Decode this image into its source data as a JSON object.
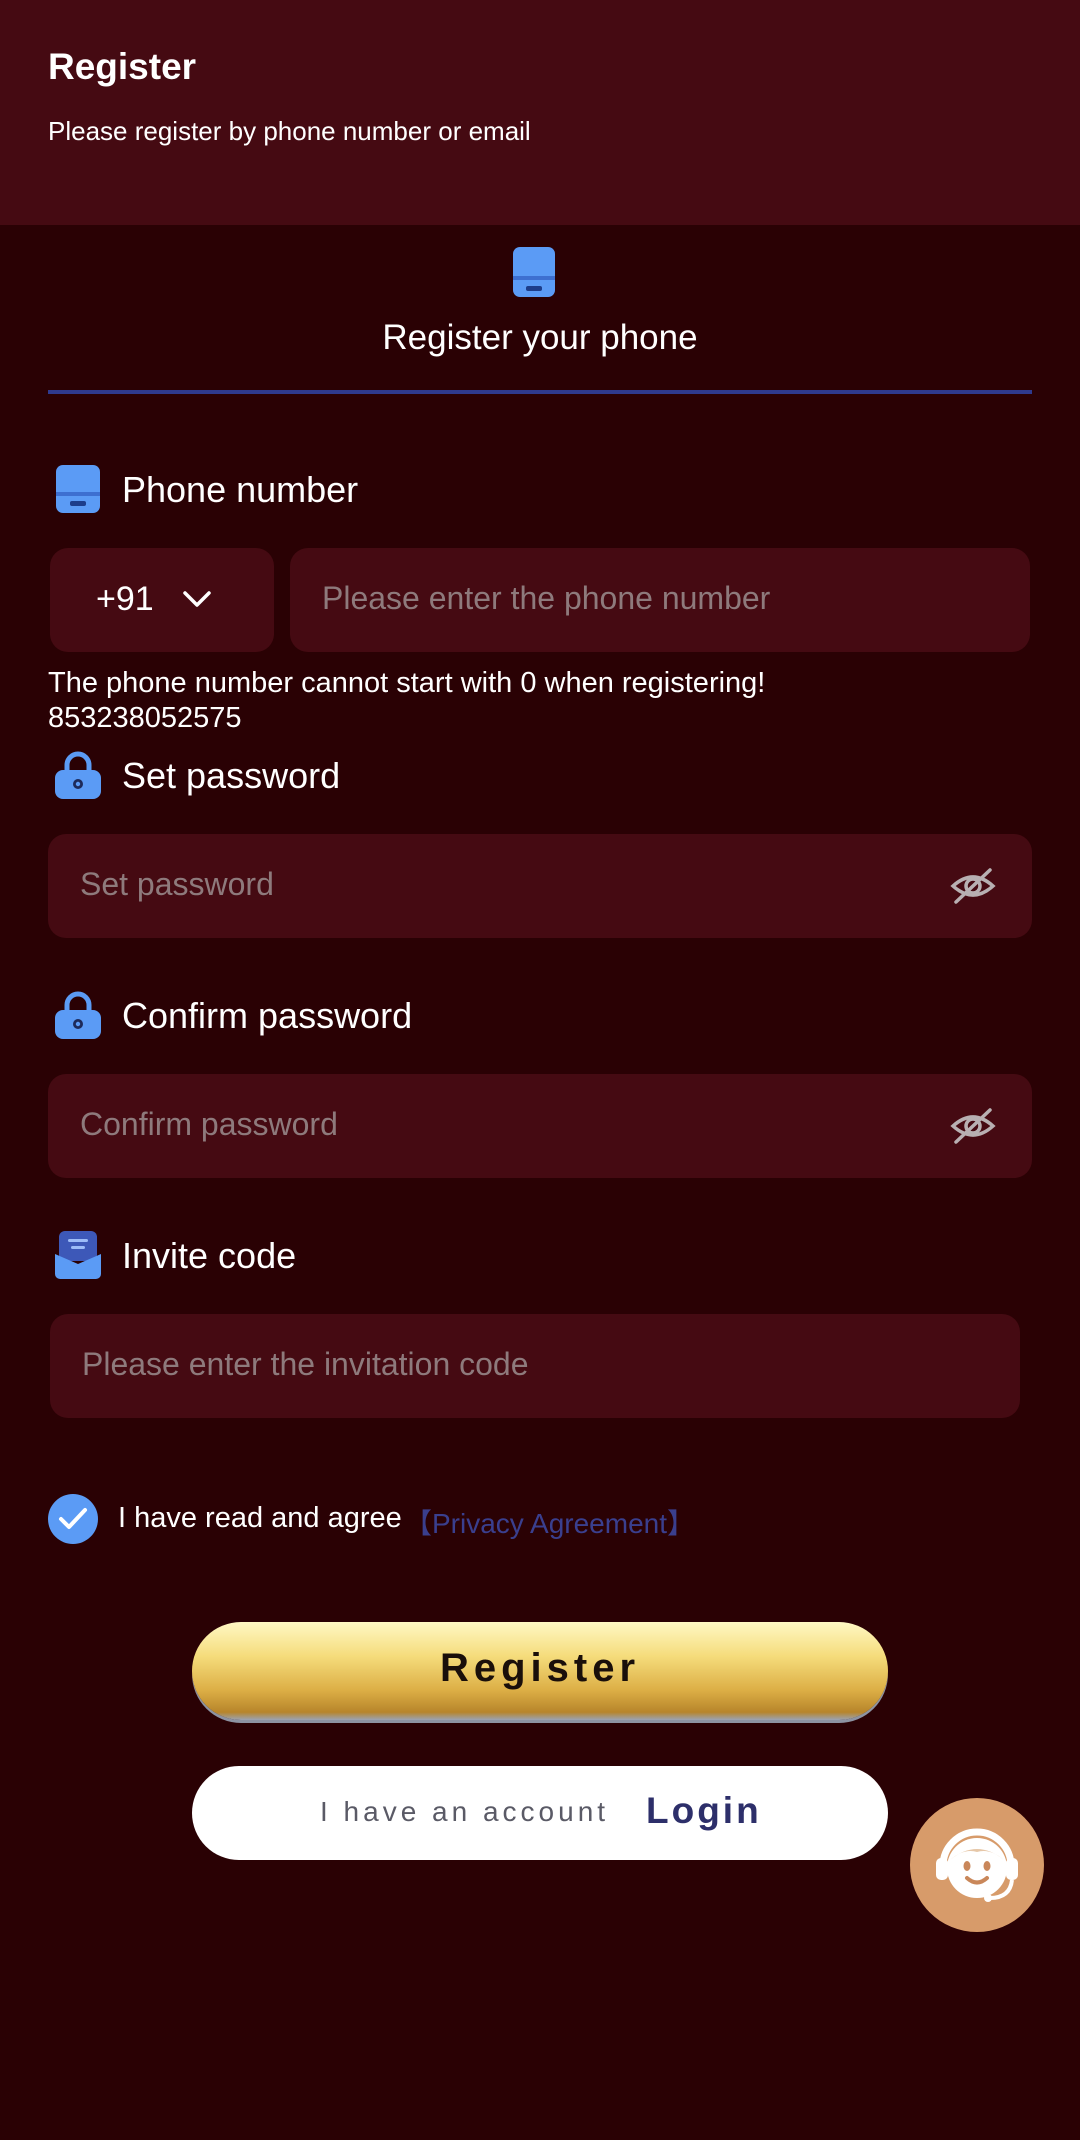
{
  "header": {
    "title": "Register",
    "subtitle": "Please register by phone number or email"
  },
  "tab": {
    "label": "Register your phone",
    "icon": "phone-icon",
    "underline_color": "#2f3a8e"
  },
  "phone_section": {
    "label": "Phone number",
    "icon": "phone-icon",
    "country_code": "+91",
    "placeholder": "Please enter the phone number"
  },
  "hint": {
    "line1": "The phone number cannot start with 0 when registering!",
    "line2": "853238052575"
  },
  "password_section": {
    "label": "Set password",
    "icon": "lock-icon",
    "placeholder": "Set password"
  },
  "confirm_section": {
    "label": "Confirm password",
    "icon": "lock-icon",
    "placeholder": "Confirm password"
  },
  "invite_section": {
    "label": "Invite code",
    "icon": "invite-icon",
    "placeholder": "Please enter the invitation code"
  },
  "agreement": {
    "checked": true,
    "text": "I have read and agree",
    "link": "【Privacy Agreement】"
  },
  "buttons": {
    "register": "Register",
    "account_prefix": "I have an account",
    "login": "Login"
  },
  "support": {
    "icon": "customer-service-icon"
  },
  "colors": {
    "background": "#2a0104",
    "header_bg": "#450a12",
    "field_bg": "#450a12",
    "accent_blue": "#5b9bf5",
    "gold": "#dcae45",
    "link": "#3a3f8e"
  }
}
